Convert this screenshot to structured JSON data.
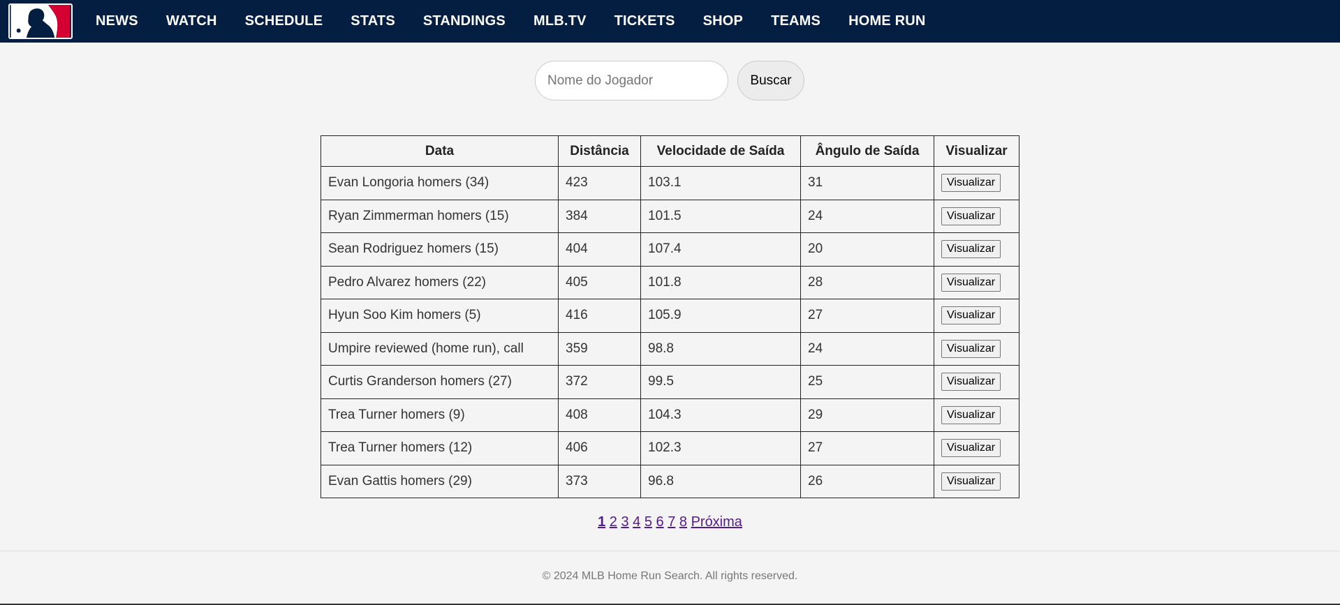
{
  "nav": {
    "items": [
      "NEWS",
      "WATCH",
      "SCHEDULE",
      "STATS",
      "STANDINGS",
      "MLB.TV",
      "TICKETS",
      "SHOP",
      "TEAMS",
      "HOME RUN"
    ]
  },
  "search": {
    "placeholder": "Nome do Jogador",
    "value": "",
    "button_label": "Buscar"
  },
  "table": {
    "headers": [
      "Data",
      "Distância",
      "Velocidade de Saída",
      "Ângulo de Saída",
      "Visualizar"
    ],
    "rows": [
      {
        "data": "Evan Longoria homers (34)",
        "distance": "423",
        "exit_velocity": "103.1",
        "launch_angle": "31",
        "button": "Visualizar"
      },
      {
        "data": "Ryan Zimmerman homers (15)",
        "distance": "384",
        "exit_velocity": "101.5",
        "launch_angle": "24",
        "button": "Visualizar"
      },
      {
        "data": "Sean Rodriguez homers (15)",
        "distance": "404",
        "exit_velocity": "107.4",
        "launch_angle": "20",
        "button": "Visualizar"
      },
      {
        "data": "Pedro Alvarez homers (22)",
        "distance": "405",
        "exit_velocity": "101.8",
        "launch_angle": "28",
        "button": "Visualizar"
      },
      {
        "data": "Hyun Soo Kim homers (5)",
        "distance": "416",
        "exit_velocity": "105.9",
        "launch_angle": "27",
        "button": "Visualizar"
      },
      {
        "data": "Umpire reviewed (home run), call",
        "distance": "359",
        "exit_velocity": "98.8",
        "launch_angle": "24",
        "button": "Visualizar"
      },
      {
        "data": "Curtis Granderson homers (27)",
        "distance": "372",
        "exit_velocity": "99.5",
        "launch_angle": "25",
        "button": "Visualizar"
      },
      {
        "data": "Trea Turner homers (9)",
        "distance": "408",
        "exit_velocity": "104.3",
        "launch_angle": "29",
        "button": "Visualizar"
      },
      {
        "data": "Trea Turner homers (12)",
        "distance": "406",
        "exit_velocity": "102.3",
        "launch_angle": "27",
        "button": "Visualizar"
      },
      {
        "data": "Evan Gattis homers (29)",
        "distance": "373",
        "exit_velocity": "96.8",
        "launch_angle": "26",
        "button": "Visualizar"
      }
    ]
  },
  "pagination": {
    "pages": [
      "1",
      "2",
      "3",
      "4",
      "5",
      "6",
      "7",
      "8"
    ],
    "current": "1",
    "next_label": "Próxima"
  },
  "footer": {
    "text": "© 2024 MLB Home Run Search. All rights reserved."
  },
  "colors": {
    "navbar": "#041e42",
    "logo_red": "#d50032",
    "logo_blue": "#041e42",
    "link_visited": "#551a8b"
  },
  "icons": {
    "logo": "mlb-logo-icon"
  }
}
